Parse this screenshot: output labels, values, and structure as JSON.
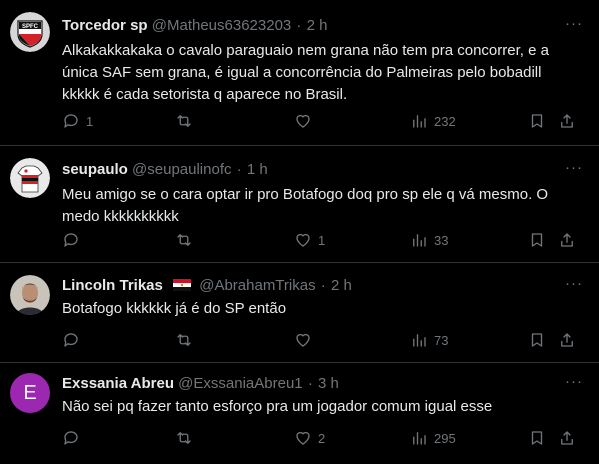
{
  "tweets": [
    {
      "name": "Torcedor sp",
      "handle": "@Matheus63623203",
      "separator": "·",
      "time": "2 h",
      "text": "Alkakakkakaka o cavalo paraguaio nem grana não tem pra concorrer, e a única SAF sem grana, é igual a concorrência do Palmeiras pelo bobadill kkkkk é cada setorista q aparece no Brasil.",
      "replies": "1",
      "retweets": "",
      "likes": "",
      "views": "232",
      "avatar": "spfc-logo"
    },
    {
      "name": "seupaulo",
      "handle": "@seupaulinofc",
      "separator": "·",
      "time": "1 h",
      "text": "Meu amigo se o cara optar ir pro Botafogo doq pro sp ele q vá mesmo. O medo kkkkkkkkkk",
      "replies": "",
      "retweets": "",
      "likes": "1",
      "views": "33",
      "avatar": "spfc-jersey"
    },
    {
      "name": "Lincoln Trikas",
      "flag": "egypt-flag",
      "handle": "@AbrahamTrikas",
      "separator": "·",
      "time": "2 h",
      "text": "Botafogo kkkkkk já é do SP então",
      "replies": "",
      "retweets": "",
      "likes": "",
      "views": "73",
      "avatar": "man-photo"
    },
    {
      "name": "Exssania Abreu",
      "handle": "@ExssaniaAbreu1",
      "separator": "·",
      "time": "3 h",
      "text": "Não sei pq fazer tanto esforço pra um jogador comum igual esse",
      "replies": "",
      "retweets": "",
      "likes": "2",
      "views": "295",
      "avatar": "letter-e",
      "avatar_letter": "E",
      "avatar_color": "#9c27b0"
    }
  ],
  "more_label": "···",
  "colors": {
    "background": "#000000",
    "text": "#e7e9ea",
    "muted": "#71767b",
    "divider": "#2f3336"
  }
}
